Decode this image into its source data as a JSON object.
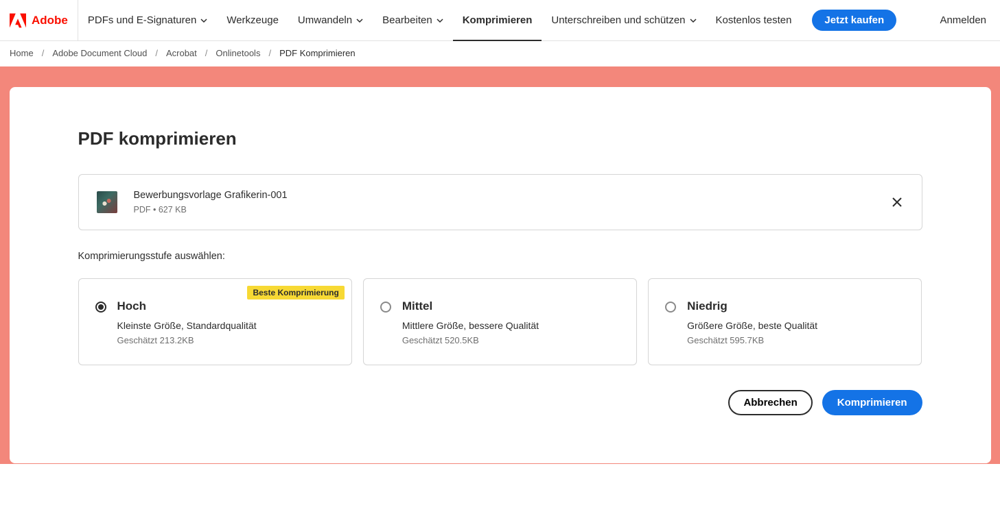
{
  "brand": {
    "name": "Adobe"
  },
  "nav": {
    "items": [
      {
        "label": "PDFs und E-Signaturen",
        "dropdown": true
      },
      {
        "label": "Werkzeuge",
        "dropdown": false
      },
      {
        "label": "Umwandeln",
        "dropdown": true
      },
      {
        "label": "Bearbeiten",
        "dropdown": true
      },
      {
        "label": "Komprimieren",
        "dropdown": false,
        "active": true
      },
      {
        "label": "Unterschreiben und schützen",
        "dropdown": true
      },
      {
        "label": "Kostenlos testen",
        "dropdown": false
      }
    ],
    "buy": "Jetzt kaufen",
    "login": "Anmelden"
  },
  "breadcrumb": {
    "items": [
      "Home",
      "Adobe Document Cloud",
      "Acrobat",
      "Onlinetools"
    ],
    "current": "PDF Komprimieren"
  },
  "page": {
    "title": "PDF komprimieren",
    "file": {
      "name": "Bewerbungsvorlage Grafikerin-001",
      "meta": "PDF • 627 KB"
    },
    "level_label": "Komprimierungsstufe auswählen:",
    "options": [
      {
        "title": "Hoch",
        "desc": "Kleinste Größe, Standardqualität",
        "estimate": "Geschätzt 213.2KB",
        "badge": "Beste Komprimierung",
        "selected": true
      },
      {
        "title": "Mittel",
        "desc": "Mittlere Größe, bessere Qualität",
        "estimate": "Geschätzt 520.5KB",
        "selected": false
      },
      {
        "title": "Niedrig",
        "desc": "Größere Größe, beste Qualität",
        "estimate": "Geschätzt 595.7KB",
        "selected": false
      }
    ],
    "actions": {
      "cancel": "Abbrechen",
      "compress": "Komprimieren"
    }
  }
}
